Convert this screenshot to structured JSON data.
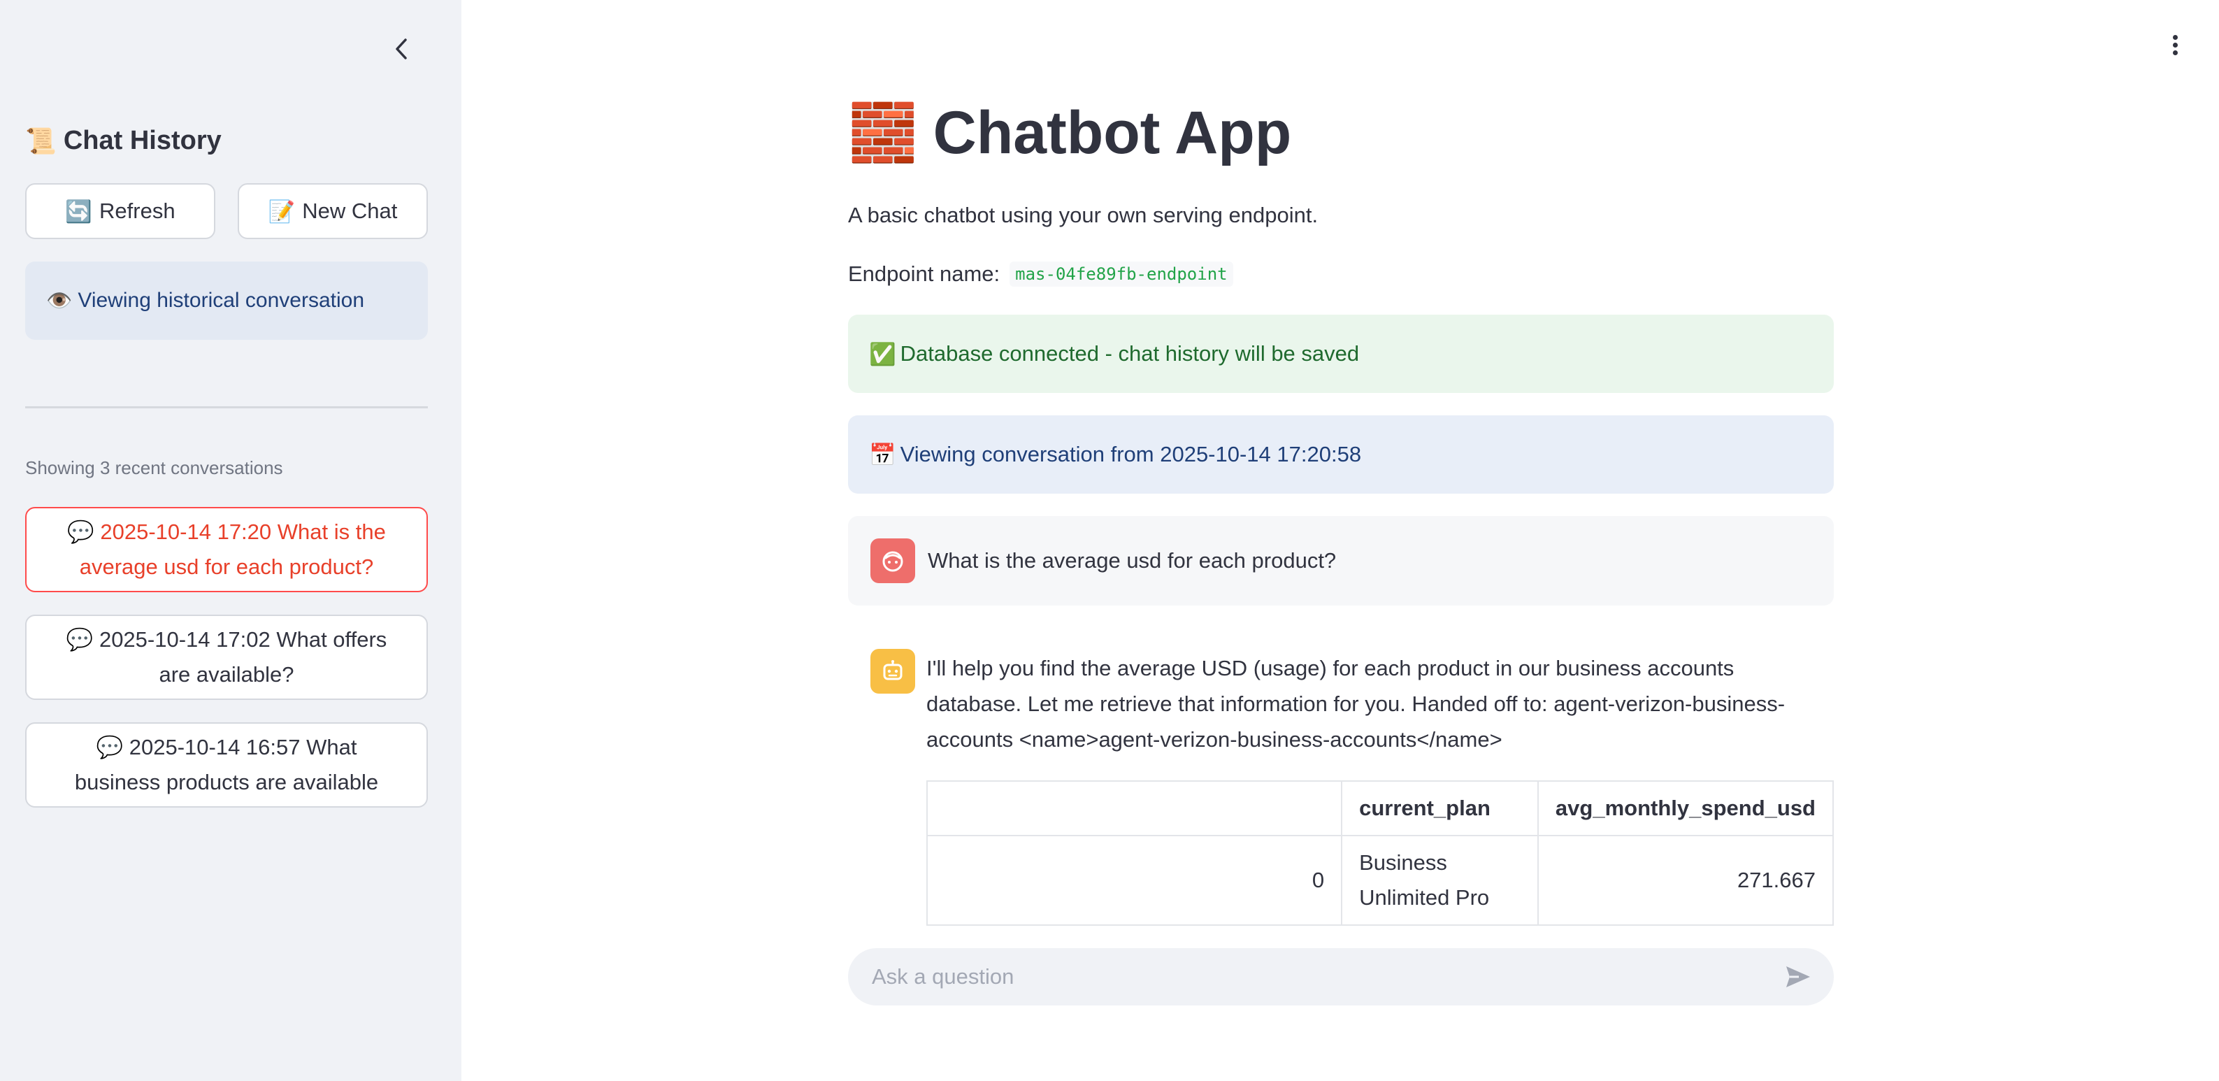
{
  "sidebar": {
    "collapse_icon": "chevron-left-icon",
    "title_emoji": "📜",
    "title": "Chat History",
    "refresh_emoji": "🔄",
    "refresh_label": "Refresh",
    "new_chat_emoji": "📝",
    "new_chat_label": "New Chat",
    "viewing_emoji": "👁️",
    "viewing_label": "Viewing historical conversation",
    "caption": "Showing 3 recent conversations",
    "conversations": [
      {
        "emoji": "💬",
        "label": "2025-10-14 17:20 What is the average usd for each product?",
        "active": true
      },
      {
        "emoji": "💬",
        "label": "2025-10-14 17:02 What offers are available?",
        "active": false
      },
      {
        "emoji": "💬",
        "label": "2025-10-14 16:57 What business products are available",
        "active": false
      }
    ]
  },
  "header": {
    "menu_icon": "more-vertical-icon"
  },
  "main": {
    "title_emoji": "🧱",
    "title": "Chatbot App",
    "subtitle": "A basic chatbot using your own serving endpoint.",
    "endpoint_label": "Endpoint name:",
    "endpoint_value": "mas-04fe89fb-endpoint",
    "db_status_emoji": "✅",
    "db_status": "Database connected - chat history will be saved",
    "viewing_emoji": "📅",
    "viewing_text": "Viewing conversation from 2025-10-14 17:20:58",
    "messages": {
      "user": "What is the average usd for each product?",
      "assistant": "I'll help you find the average USD (usage) for each product in our business accounts database. Let me retrieve that information for you. Handed off to: agent-verizon-business-accounts <name>agent-verizon-business-accounts</name>"
    },
    "table": {
      "columns": [
        "",
        "current_plan",
        "avg_monthly_spend_usd"
      ],
      "rows": [
        {
          "index": "0",
          "current_plan": "Business Unlimited Pro",
          "avg_monthly_spend_usd": "271.667"
        }
      ]
    },
    "input": {
      "placeholder": "Ask a question",
      "value": ""
    }
  },
  "colors": {
    "sidebar_bg": "#f0f2f6",
    "accent": "#ff4b4b",
    "success_bg": "#eaf6ec",
    "info_bg": "#e8eef8",
    "code_green": "#21a348",
    "user_avatar": "#ee6e6b",
    "bot_avatar": "#f8bf45"
  }
}
